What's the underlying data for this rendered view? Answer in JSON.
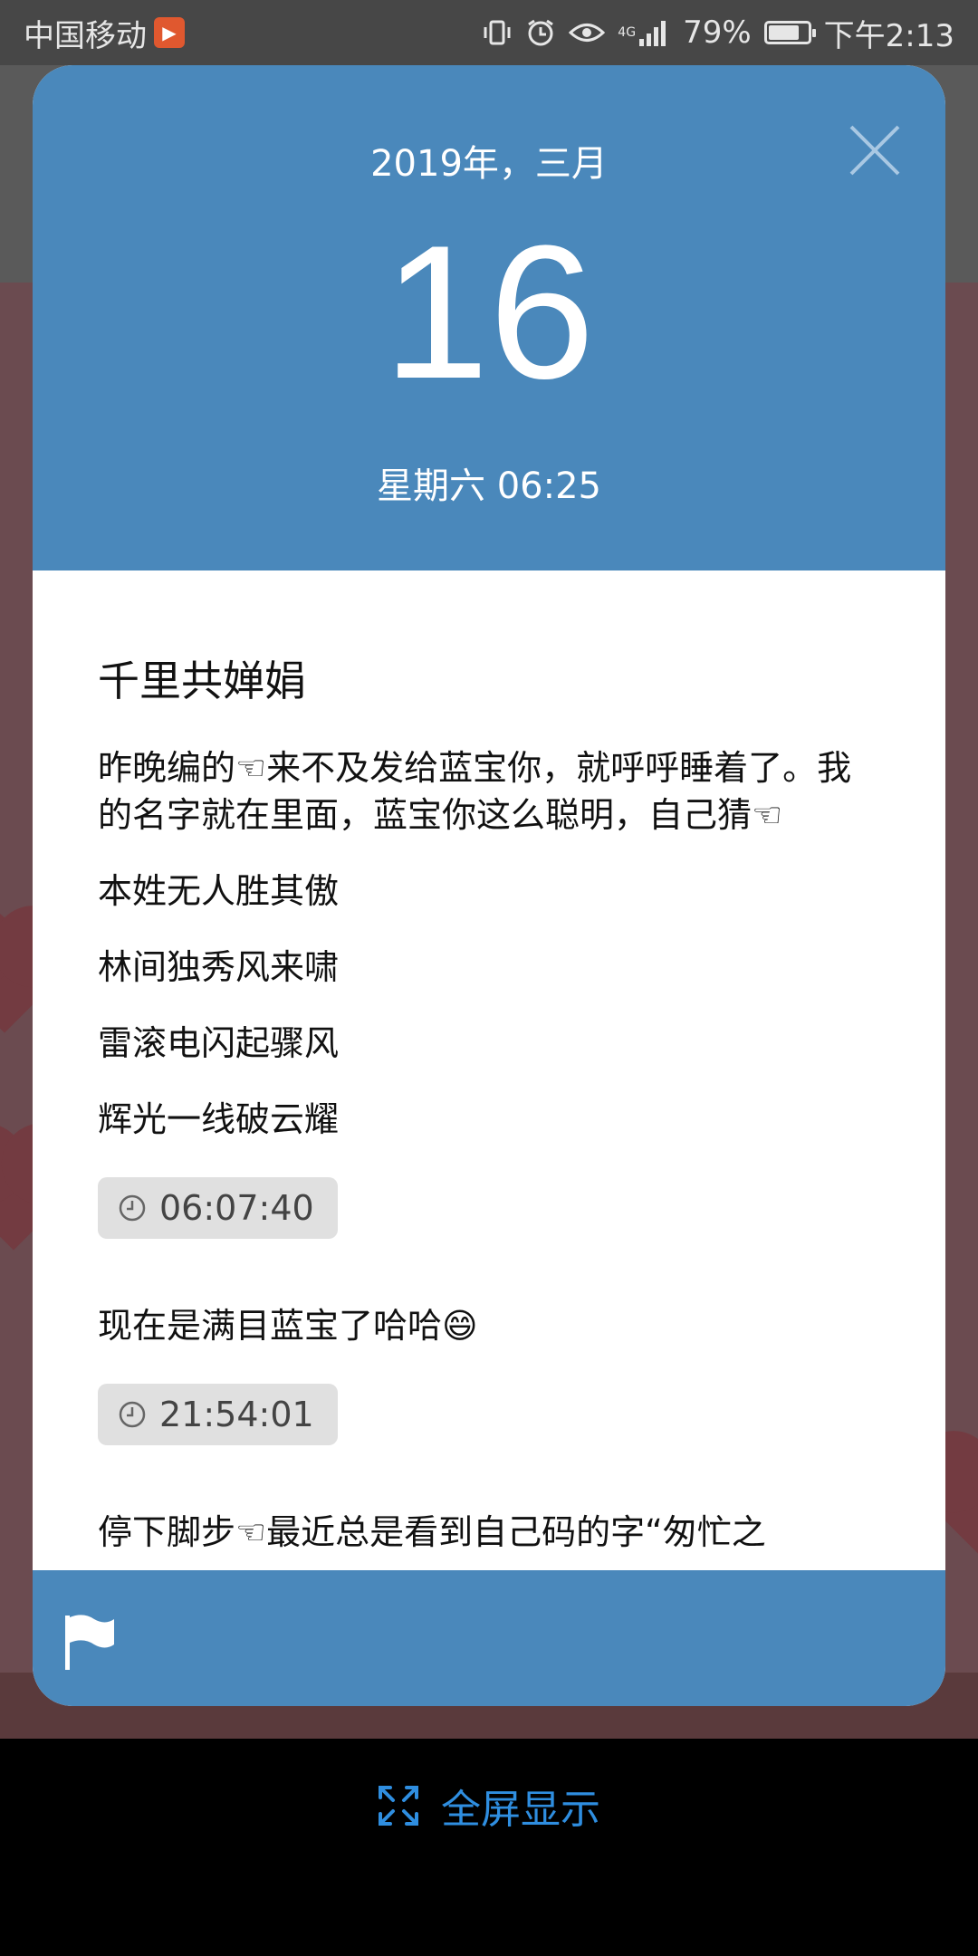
{
  "status_bar": {
    "carrier": "中国移动",
    "network": "4G",
    "battery": "79%",
    "battery_level": 0.79,
    "time": "下午2:13"
  },
  "card": {
    "year_month": "2019年，三月",
    "day": "16",
    "weekday_time": "星期六 06:25",
    "entries": [
      {
        "title": "千里共婵娟",
        "paragraphs": [
          "昨晚编的☜来不及发给蓝宝你，就呼呼睡着了。我的名字就在里面，蓝宝你这么聪明，自己猜☜",
          "本姓无人胜其傲",
          "林间独秀风来啸",
          "雷滚电闪起骤风",
          "辉光一线破云耀"
        ],
        "time": "06:07:40"
      },
      {
        "paragraphs": [
          "现在是满目蓝宝了哈哈😄"
        ],
        "time": "21:54:01"
      },
      {
        "paragraphs": [
          "停下脚步☜最近总是看到自己码的字“匆忙之"
        ]
      }
    ]
  },
  "bottom": {
    "fullscreen_label": "全屏显示"
  },
  "colors": {
    "header_blue": "#4a88bb",
    "link_blue": "#2f8ee0",
    "chip_bg": "#e0e0e0"
  },
  "icons": {
    "close": "close-icon",
    "clock": "clock-icon",
    "flag": "flag-icon",
    "fullscreen": "fullscreen-icon"
  }
}
